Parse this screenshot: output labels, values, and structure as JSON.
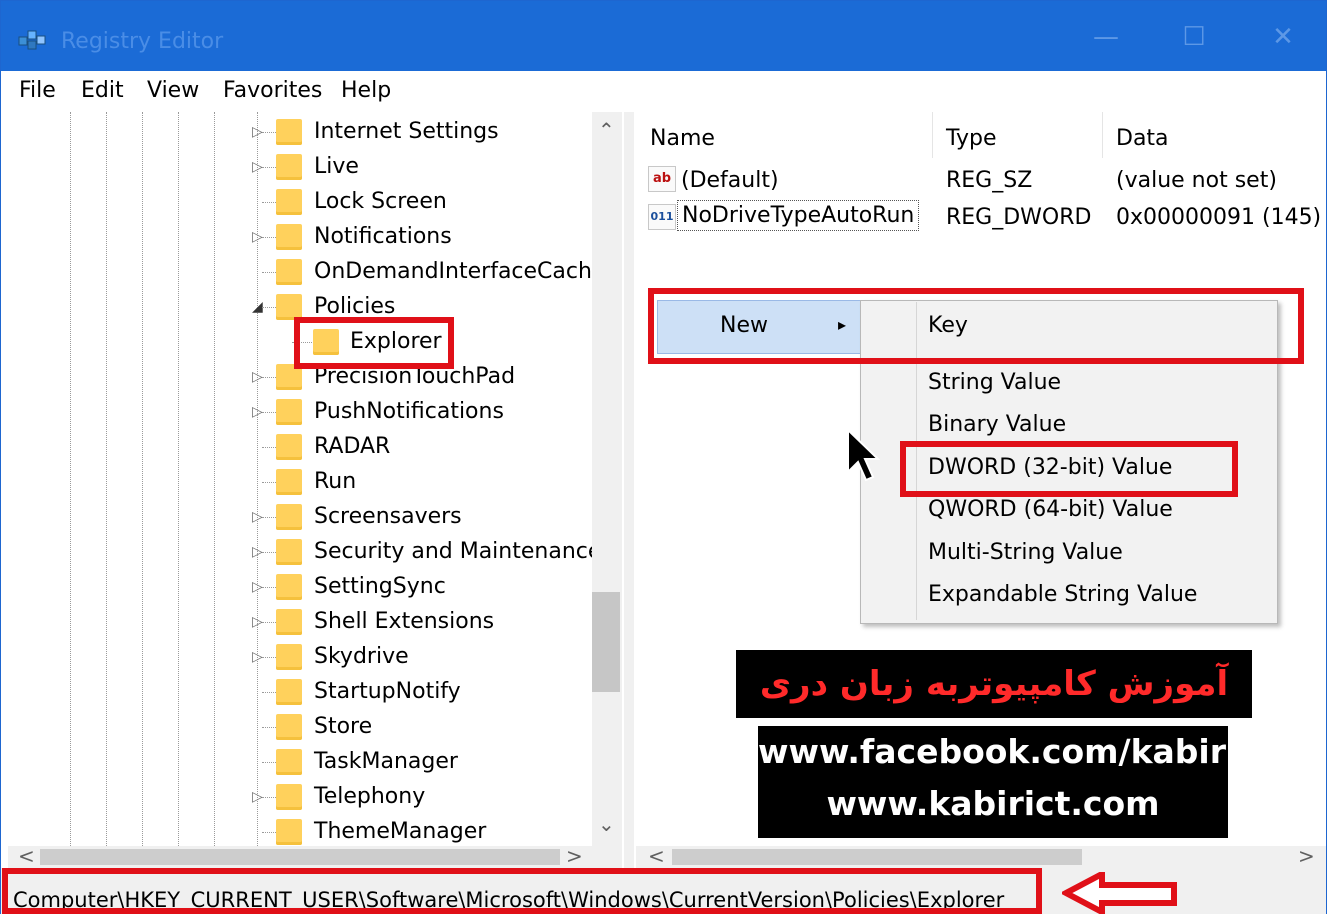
{
  "window": {
    "title": "Registry Editor",
    "controls": [
      "—",
      "☐",
      "✕"
    ]
  },
  "menubar": [
    "File",
    "Edit",
    "View",
    "Favorites",
    "Help"
  ],
  "tree": {
    "items": [
      {
        "label": "Internet Settings",
        "expander": "▷"
      },
      {
        "label": "Live",
        "expander": "▷"
      },
      {
        "label": "Lock Screen",
        "expander": ""
      },
      {
        "label": "Notifications",
        "expander": "▷"
      },
      {
        "label": "OnDemandInterfaceCache",
        "expander": ""
      },
      {
        "label": "Policies",
        "expander": "◢"
      },
      {
        "label": "Explorer",
        "expander": ""
      },
      {
        "label": "PrecisionTouchPad",
        "expander": "▷"
      },
      {
        "label": "PushNotifications",
        "expander": "▷"
      },
      {
        "label": "RADAR",
        "expander": ""
      },
      {
        "label": "Run",
        "expander": ""
      },
      {
        "label": "Screensavers",
        "expander": "▷"
      },
      {
        "label": "Security and Maintenance",
        "expander": "▷"
      },
      {
        "label": "SettingSync",
        "expander": "▷"
      },
      {
        "label": "Shell Extensions",
        "expander": "▷"
      },
      {
        "label": "Skydrive",
        "expander": "▷"
      },
      {
        "label": "StartupNotify",
        "expander": ""
      },
      {
        "label": "Store",
        "expander": ""
      },
      {
        "label": "TaskManager",
        "expander": ""
      },
      {
        "label": "Telephony",
        "expander": "▷"
      },
      {
        "label": "ThemeManager",
        "expander": ""
      }
    ]
  },
  "list": {
    "columns": [
      "Name",
      "Type",
      "Data"
    ],
    "rows": [
      {
        "icon": "ab",
        "name": "(Default)",
        "type": "REG_SZ",
        "data": "(value not set)"
      },
      {
        "icon": "011",
        "name": "NoDriveTypeAutoRun",
        "type": "REG_DWORD",
        "data": "0x00000091 (145)"
      }
    ]
  },
  "context_menu": {
    "parent": "New",
    "items": [
      "Key",
      "String Value",
      "Binary Value",
      "DWORD (32-bit) Value",
      "QWORD (64-bit) Value",
      "Multi-String Value",
      "Expandable String Value"
    ]
  },
  "status_path": "Computer\\HKEY_CURRENT_USER\\Software\\Microsoft\\Windows\\CurrentVersion\\Policies\\Explorer",
  "watermark": {
    "line1": "آموزش کامپیوتربه زبان دری",
    "line2": "www.facebook.com/kabirict",
    "line3": "www.kabirict.com"
  },
  "colors": {
    "titlebar": "#1b6bd6",
    "highlight": "#e01018",
    "folder": "#ffd15c"
  }
}
